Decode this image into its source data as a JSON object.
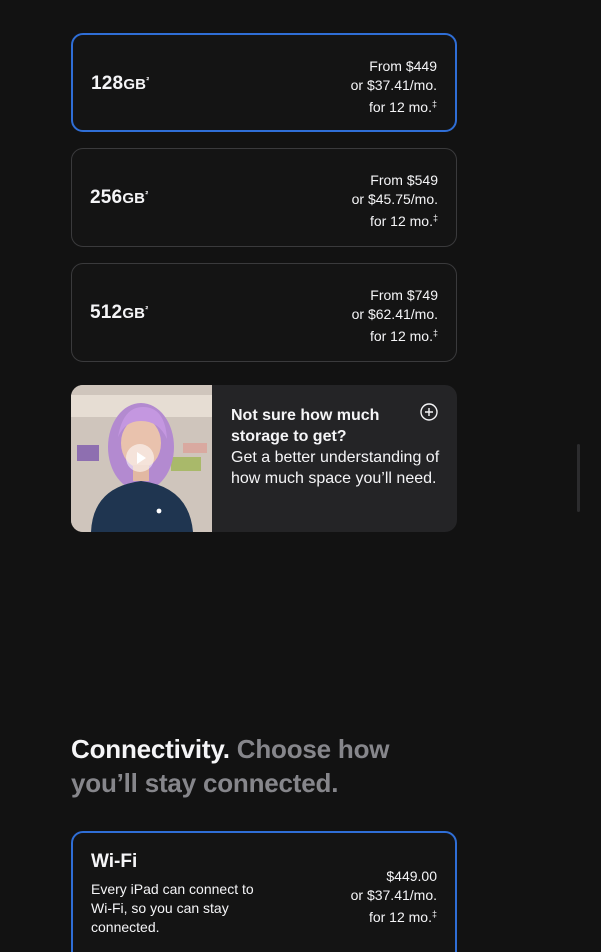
{
  "storage": {
    "options": [
      {
        "capacity": "128",
        "unit": "GB",
        "footnote": "²",
        "price_from": "From $449",
        "price_monthly": "or $37.41/mo.",
        "term": "for 12 mo.",
        "term_mark": "‡",
        "selected": true
      },
      {
        "capacity": "256",
        "unit": "GB",
        "footnote": "²",
        "price_from": "From $549",
        "price_monthly": "or $45.75/mo.",
        "term": "for 12 mo.",
        "term_mark": "‡",
        "selected": false
      },
      {
        "capacity": "512",
        "unit": "GB",
        "footnote": "²",
        "price_from": "From $749",
        "price_monthly": "or $62.41/mo.",
        "term": "for 12 mo.",
        "term_mark": "‡",
        "selected": false
      }
    ],
    "help": {
      "title": "Not sure how much storage to get?",
      "body": "Get a better understanding of how much space you’ll need.",
      "icon": "plus-circle-icon",
      "video_icon": "play-icon"
    }
  },
  "connectivity": {
    "heading_lead": "Connectivity.",
    "heading_rest": "Choose how you’ll stay connected.",
    "options": [
      {
        "name": "Wi-Fi",
        "description": "Every iPad can connect to Wi-Fi, so you can stay connected.",
        "price": "$449.00",
        "price_monthly": "or $37.41/mo.",
        "term": "for 12 mo.",
        "term_mark": "‡",
        "selected": true
      }
    ]
  },
  "colors": {
    "background": "#121212",
    "selected_border": "#2f6ed6",
    "card_border": "#3a3a3c",
    "help_card": "#242426",
    "muted_text": "#86868b"
  }
}
